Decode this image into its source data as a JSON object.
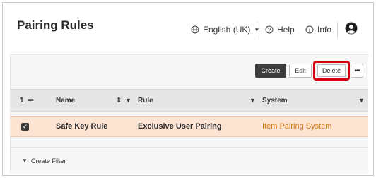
{
  "header": {
    "title": "Pairing Rules",
    "language": "English (UK)",
    "help": "Help",
    "info": "Info",
    "language_icon": "globe-icon",
    "help_icon": "question-circle-icon",
    "info_icon": "info-circle-icon",
    "user_icon": "user-avatar-icon"
  },
  "toolbar": {
    "create": "Create",
    "edit": "Edit",
    "delete": "Delete",
    "more": "•••"
  },
  "table": {
    "selection_count": "1",
    "count_more": "•••",
    "columns": [
      "Name",
      "Rule",
      "System"
    ],
    "rows": [
      {
        "name": "Safe Key Rule",
        "rule": "Exclusive User Pairing",
        "system": "Item Pairing System",
        "selected": true
      }
    ]
  },
  "filter": {
    "label": "Create Filter"
  },
  "colors": {
    "highlight": "#d4000f",
    "selected_row": "#fde3d2",
    "link": "#d17a1a"
  }
}
